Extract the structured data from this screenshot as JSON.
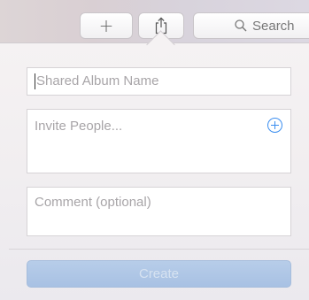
{
  "toolbar": {
    "search_label": "Search"
  },
  "form": {
    "album_name_placeholder": "Shared Album Name",
    "invite_placeholder": "Invite People...",
    "comment_placeholder": "Comment (optional)",
    "create_label": "Create"
  },
  "colors": {
    "accent": "#3b8ef0",
    "create_button": "#a8c1e3"
  },
  "icons": {
    "add": "plus-icon",
    "share": "share-icon",
    "search": "search-icon",
    "invite_add": "add-contact-icon"
  }
}
